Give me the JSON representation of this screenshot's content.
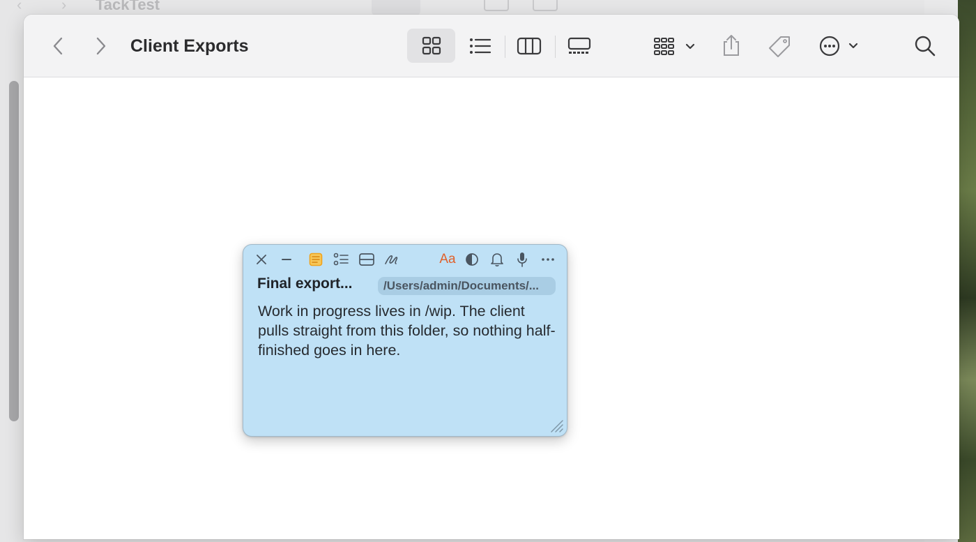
{
  "background_window": {
    "title": "TackTest"
  },
  "window": {
    "title": "Client Exports"
  },
  "toolbar": {
    "icons": [
      "chevron-left-icon",
      "chevron-right-icon",
      "icon-view-grid-icon",
      "list-view-icon",
      "column-view-icon",
      "gallery-view-icon",
      "group-by-icon",
      "share-icon",
      "tag-icon",
      "more-actions-icon",
      "search-icon"
    ]
  },
  "note": {
    "title": "Final export...",
    "path": "/Users/admin/Documents/...",
    "body": "Work in progress lives in /wip. The client pulls straight from this folder, so nothing half-finished goes in here.",
    "colors": {
      "background": "#bfe1f6",
      "accent_orange": "#f0a31c",
      "text_orange": "#e0602a"
    }
  }
}
